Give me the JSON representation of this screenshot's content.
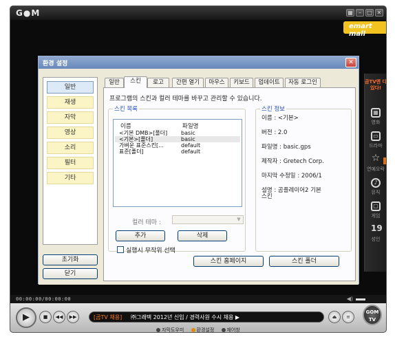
{
  "player": {
    "logo": "G●M",
    "ad_strip": "emart mall",
    "window_buttons": [
      "▦",
      "–",
      "□",
      "✕"
    ],
    "time": "00:00:00/00:00:00",
    "ticker_tag": "[곰TV 채용]",
    "ticker_text": "㈜그래텍 2012년 신입 / 경력사원 수시 채용 ▶",
    "bottom_links": [
      "자막도우미",
      "환경설정",
      "재어창"
    ],
    "logo_badge_top": "GOM",
    "logo_badge_bottom": "TV"
  },
  "side_panel": {
    "ad": "곰TV엔 다 있다!",
    "items": [
      {
        "label": "영화",
        "icon": "film-icon"
      },
      {
        "label": "드라마",
        "icon": "tv-icon"
      },
      {
        "label": "연예오락",
        "icon": "star-icon"
      },
      {
        "label": "뮤직",
        "icon": "music-icon"
      },
      {
        "label": "게임",
        "icon": "game-icon"
      },
      {
        "label": "성인",
        "icon": "adult-icon",
        "glyph": "19"
      }
    ]
  },
  "dialog": {
    "title": "환경 설정",
    "categories": [
      "일반",
      "재생",
      "자막",
      "영상",
      "소리",
      "필터",
      "기타"
    ],
    "active_category": "일반",
    "reset_label": "초기화",
    "close_label": "닫기",
    "tabs": [
      "일반",
      "스킨",
      "로고",
      "간편 열기",
      "마우스",
      "키보드",
      "업데이트",
      "자동 로그인"
    ],
    "active_tab": "스킨",
    "description": "프로그램의 스킨과 컬러 테마를 바꾸고 관리할 수 있습니다.",
    "skin_list": {
      "title": "스킨 목록",
      "col_name": "이름",
      "col_file": "파일명",
      "rows": [
        {
          "name": "<기본 DMB>[폴더]",
          "file": "basic"
        },
        {
          "name": "<기본>[폴더]",
          "file": "basic"
        },
        {
          "name": "가벼운 표준스킨[...",
          "file": "default"
        },
        {
          "name": "표준[폴더]",
          "file": "default"
        }
      ],
      "selected_index": 1
    },
    "color_theme_label": "컬러 테마 :",
    "add_label": "추가",
    "delete_label": "삭제",
    "random_label": "실행시 무작위 선택",
    "skin_info": {
      "title": "스킨 정보",
      "name": "이름 : <기본>",
      "version": "버전 : 2.0",
      "filename": "파일명 : basic.gps",
      "author": "제작자 : Gretech Corp.",
      "modified": "마지막 수정일 : 2006/1",
      "desc_line1": "설명 : 곰플레이어2 기본",
      "desc_line2": "스킨"
    },
    "skin_homepage_label": "스킨 홈페이지",
    "skin_folder_label": "스킨 폴더"
  }
}
